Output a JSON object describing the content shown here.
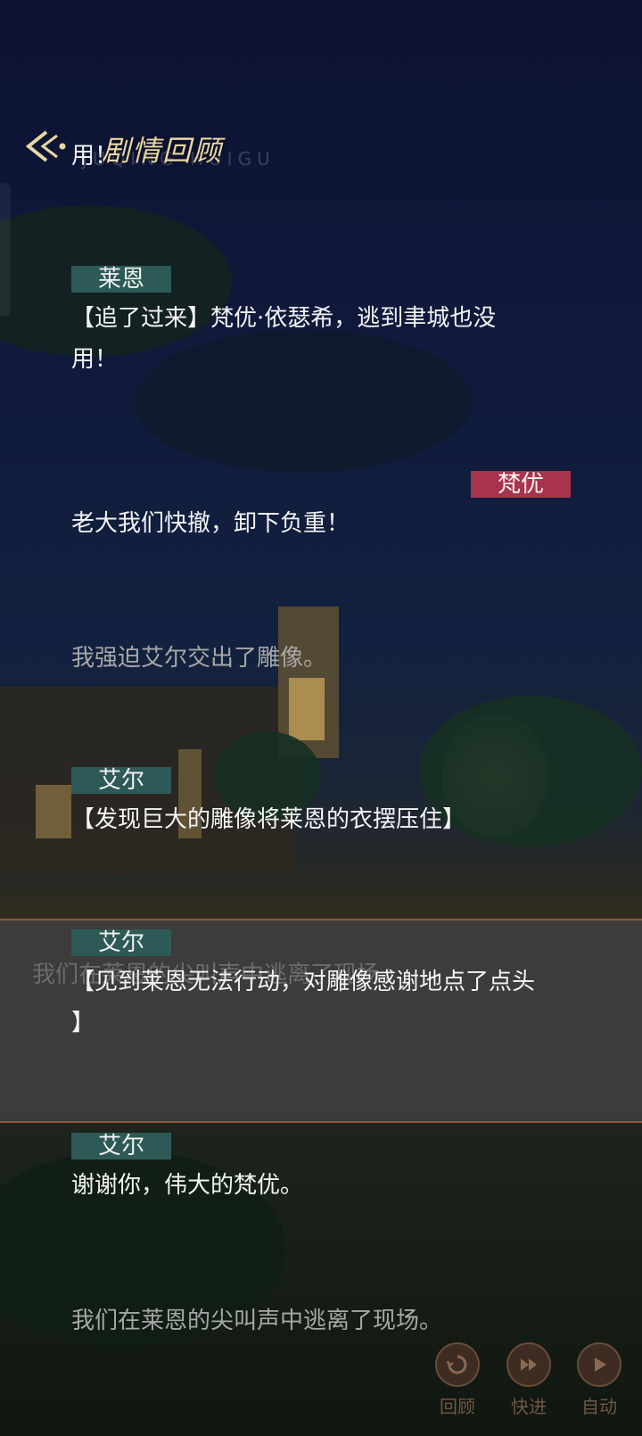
{
  "header": {
    "title": "剧情回顾",
    "title_pinyin": "JUQING HUIGU"
  },
  "log": {
    "top_fragment": "用！",
    "entries": [
      {
        "type": "dialogue",
        "speaker": "莱恩",
        "speaker_color": "#2d5a56",
        "text": "【追了过来】梵优·依瑟希，逃到聿城也没\n用！"
      },
      {
        "type": "dialogue",
        "speaker": "梵优",
        "speaker_color": "#a8334f",
        "text": "老大我们快撤，卸下负重！"
      },
      {
        "type": "narration",
        "text": "我强迫艾尔交出了雕像。"
      },
      {
        "type": "dialogue",
        "speaker": "艾尔",
        "speaker_color": "#2d5a56",
        "text": "【发现巨大的雕像将莱恩的衣摆压住】"
      },
      {
        "type": "dialogue",
        "speaker": "艾尔",
        "speaker_color": "#2d5a56",
        "text": "【见到莱恩无法行动，对雕像感谢地点了点头\n】"
      },
      {
        "type": "dialogue",
        "speaker": "艾尔",
        "speaker_color": "#2d5a56",
        "text": "谢谢你，伟大的梵优。"
      },
      {
        "type": "narration",
        "text": "我们在莱恩的尖叫声中逃离了现场。"
      }
    ]
  },
  "background_dialog": {
    "text": "我们在莱恩的尖叫声中逃离了现场。"
  },
  "controls": [
    {
      "label": "回顾",
      "icon": "history-icon"
    },
    {
      "label": "快进",
      "icon": "fast-forward-icon"
    },
    {
      "label": "自动",
      "icon": "play-icon"
    }
  ],
  "colors": {
    "accent_gold": "#e9d7a4",
    "speaker_teal": "#2d5a56",
    "speaker_rose": "#a8334f"
  }
}
